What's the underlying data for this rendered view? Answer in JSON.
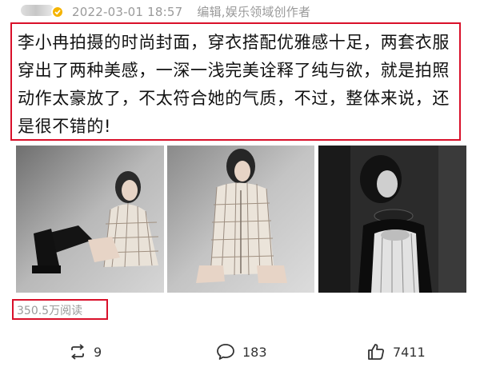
{
  "post": {
    "timestamp": "2022-03-01 18:57",
    "author_tag": "编辑,娱乐领域创作者",
    "body_text": "李小冉拍摄的时尚封面，穿衣搭配优雅感十足，两套衣服穿出了两种美感，一深一浅完美诠释了纯与欲，就是拍照动作太豪放了，不太符合她的气质，不过，整体来说，还是很不错的!",
    "reads": "350.5万阅读"
  },
  "actions": {
    "repost_count": "9",
    "comment_count": "183",
    "like_count": "7411"
  },
  "icons": {
    "verified": "verified-badge-icon",
    "repost": "repost-icon",
    "comment": "comment-icon",
    "like": "thumbs-up-icon"
  },
  "colors": {
    "highlight_border": "#d9102a",
    "meta_text": "#9a9a9a",
    "verified_badge": "#f5b400"
  }
}
